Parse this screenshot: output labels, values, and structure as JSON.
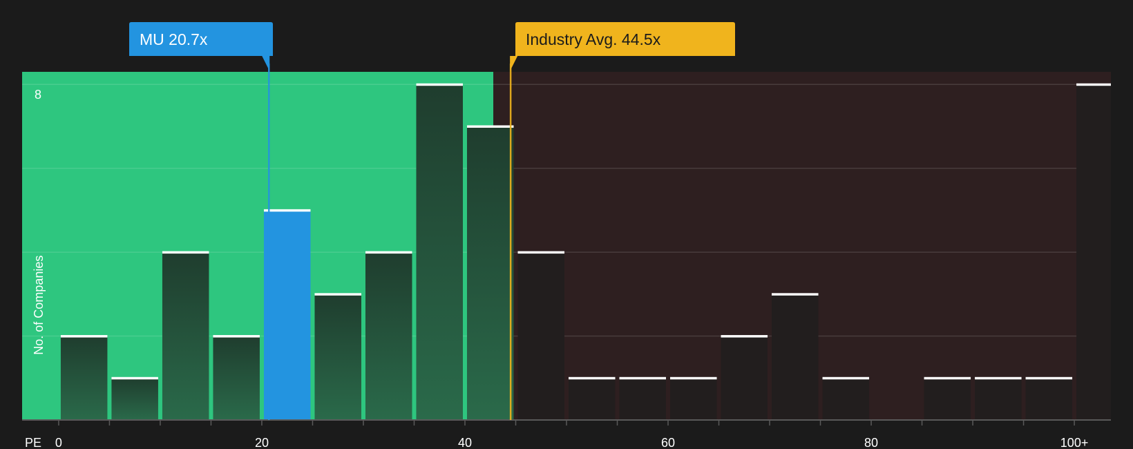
{
  "chart_data": {
    "type": "bar",
    "x_axis_label": "PE",
    "y_axis_label": "No. of Companies",
    "x_ticks": [
      "0",
      "20",
      "40",
      "60",
      "80",
      "100+"
    ],
    "y_ticks": [
      "8"
    ],
    "bin_width": 5,
    "x_range": [
      -3.6,
      103.6
    ],
    "ylim": [
      0,
      8.3
    ],
    "bins": [
      {
        "start": 0,
        "count": 2
      },
      {
        "start": 5,
        "count": 1
      },
      {
        "start": 10,
        "count": 4
      },
      {
        "start": 15,
        "count": 2
      },
      {
        "start": 20,
        "count": 5
      },
      {
        "start": 25,
        "count": 3
      },
      {
        "start": 30,
        "count": 4
      },
      {
        "start": 35,
        "count": 8
      },
      {
        "start": 40,
        "count": 7
      },
      {
        "start": 45,
        "count": 4
      },
      {
        "start": 50,
        "count": 1
      },
      {
        "start": 55,
        "count": 1
      },
      {
        "start": 60,
        "count": 1
      },
      {
        "start": 65,
        "count": 2
      },
      {
        "start": 70,
        "count": 3
      },
      {
        "start": 75,
        "count": 1
      },
      {
        "start": 80,
        "count": 0
      },
      {
        "start": 85,
        "count": 1
      },
      {
        "start": 90,
        "count": 1
      },
      {
        "start": 95,
        "count": 1
      },
      {
        "start": 100,
        "count": 8
      }
    ],
    "company": {
      "label": "MU 20.7x",
      "value": 20.7,
      "color": "#2394e0"
    },
    "industry_avg": {
      "label": "Industry Avg. 44.5x",
      "value": 44.5,
      "color": "#f0b41d"
    },
    "undervalued_region_end": 42.8,
    "colors": {
      "background": "#1b1b1b",
      "green_zone": "#2ec67f",
      "red_zone": "#2e1f20",
      "bar_in_green": "#234a36",
      "bar_in_red": "#221e1e",
      "bar_top": "#ffffff"
    }
  }
}
